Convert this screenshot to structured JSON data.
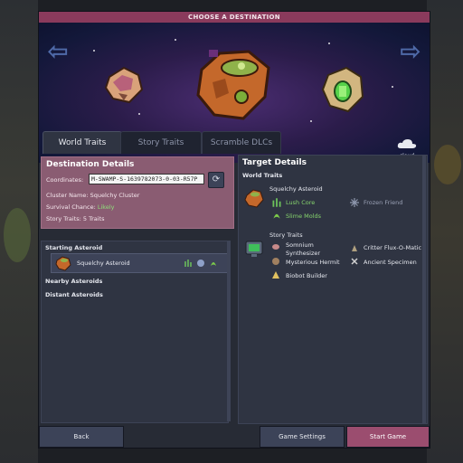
{
  "window": {
    "title": "CHOOSE A DESTINATION"
  },
  "banner": {
    "prev_arrow": "⇦",
    "next_arrow": "⇨",
    "cloud_label": "cloud"
  },
  "tabs": [
    {
      "label": "World Traits"
    },
    {
      "label": "Story Traits"
    },
    {
      "label": "Scramble DLCs"
    }
  ],
  "destination": {
    "title": "Destination Details",
    "coordinates_label": "Coordinates:",
    "coordinates_value": "M-SWAMP-S-1639782073-0-03-R57P",
    "cluster_name": "Cluster Name: Squelchy Cluster",
    "survival_prefix": "Survival Chance: ",
    "survival_value": "Likely",
    "story_traits": "Story Traits: 5 Traits"
  },
  "asteroid_list": {
    "starting_label": "Starting Asteroid",
    "starting_item": "Squelchy Asteroid",
    "nearby_label": "Nearby Asteroids",
    "distant_label": "Distant Asteroids"
  },
  "target": {
    "title": "Target Details",
    "world_traits_label": "World Traits",
    "asteroid_name": "Squelchy Asteroid",
    "traits": {
      "lush_core": "Lush Core",
      "slime_molds": "Slime Molds",
      "frozen_friend": "Frozen Friend"
    },
    "story_traits_label": "Story Traits",
    "story": {
      "somnium_1": "Somnium",
      "somnium_2": "Synthesizer",
      "critter": "Critter Flux-O-Matic",
      "hermit": "Mysterious Hermit",
      "specimen": "Ancient Specimen",
      "biobot": "Biobot Builder"
    }
  },
  "buttons": {
    "back": "Back",
    "game_settings": "Game Settings",
    "start_game": "Start Game"
  },
  "colors": {
    "title_bar": "#8a3a5c",
    "details_box": "#8a5c72",
    "start_button": "#9b4d6f",
    "good_value": "#8fe07b"
  }
}
